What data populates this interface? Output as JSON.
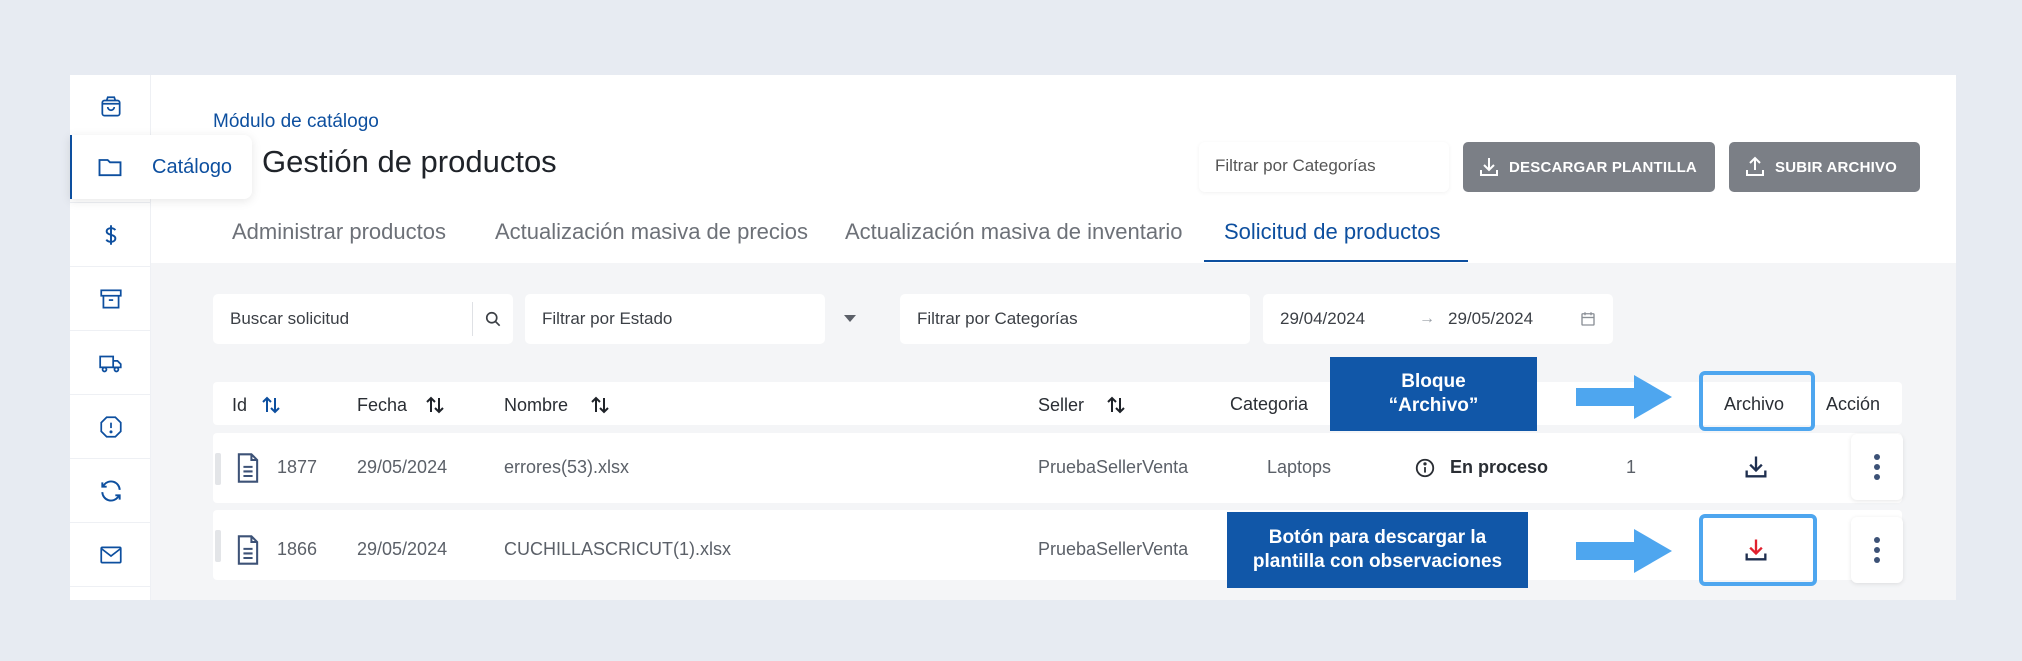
{
  "sidebar": {
    "items": [
      {
        "icon": "shopping-bag-icon"
      },
      {
        "icon": "folder-icon"
      },
      {
        "icon": "dollar-icon"
      },
      {
        "icon": "archive-icon"
      },
      {
        "icon": "truck-icon"
      },
      {
        "icon": "alert-octagon-icon"
      },
      {
        "icon": "refresh-icon"
      },
      {
        "icon": "mail-icon"
      }
    ],
    "flyout_label": "Catálogo"
  },
  "breadcrumb": "Módulo de catálogo",
  "page_title": "Gestión de productos",
  "header_actions": {
    "category_filter_placeholder": "Filtrar por Categorías",
    "download_label": "DESCARGAR PLANTILLA",
    "upload_label": "SUBIR ARCHIVO"
  },
  "tabs": [
    {
      "label": "Administrar productos"
    },
    {
      "label": "Actualización masiva de precios"
    },
    {
      "label": "Actualización masiva de inventario"
    },
    {
      "label": "Solicitud de productos",
      "active": true
    }
  ],
  "filters": {
    "search_placeholder": "Buscar solicitud",
    "estado_placeholder": "Filtrar por Estado",
    "category_placeholder": "Filtrar por Categorías",
    "date_from": "29/04/2024",
    "date_to": "29/05/2024",
    "date_separator": "→"
  },
  "table": {
    "headers": {
      "id": "Id",
      "fecha": "Fecha",
      "nombre": "Nombre",
      "seller": "Seller",
      "categoria": "Categoria",
      "archivo": "Archivo",
      "accion": "Acción"
    },
    "rows": [
      {
        "id": "1877",
        "fecha": "29/05/2024",
        "nombre": "errores(53).xlsx",
        "seller": "PruebaSellerVenta",
        "categoria": "Laptops",
        "estado": "En proceso",
        "cantidad": "1"
      },
      {
        "id": "1866",
        "fecha": "29/05/2024",
        "nombre": "CUCHILLASCRICUT(1).xlsx",
        "seller": "PruebaSellerVenta",
        "categoria": "",
        "estado": "",
        "cantidad": ""
      }
    ]
  },
  "annotations": {
    "archivo_block_line1": "Bloque",
    "archivo_block_line2": "“Archivo”",
    "download_button_line1": "Botón para descargar la",
    "download_button_line2": "plantilla con observaciones"
  },
  "colors": {
    "brand_blue": "#0d4f9f",
    "annotation_blue": "#1157a8",
    "highlight_outline": "#4ea6ef",
    "download_red": "#e0202e",
    "button_grey": "#7b7f86"
  }
}
